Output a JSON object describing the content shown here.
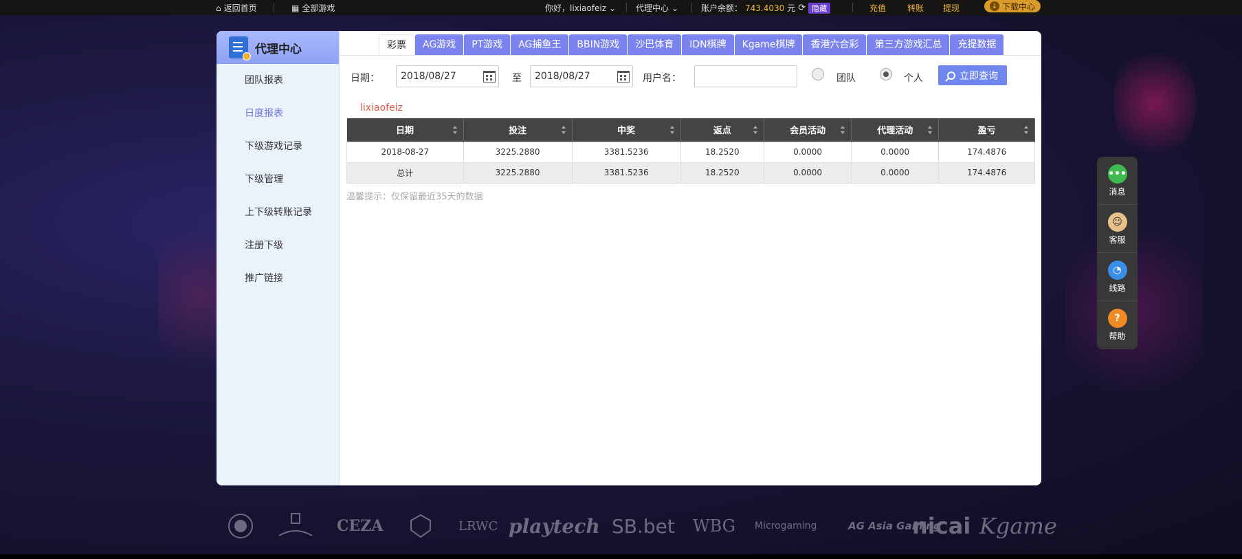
{
  "topbar": {
    "home": "返回首页",
    "all_games": "全部游戏",
    "greeting": "你好，lixiaofeiz",
    "agent_center": "代理中心",
    "balance_label": "账户余额：",
    "balance_value": "743.4030",
    "balance_unit": "元",
    "hide": "隐藏",
    "recharge": "充值",
    "transfer": "转账",
    "withdraw": "提现",
    "download": "下载中心"
  },
  "sidebar": {
    "title": "代理中心",
    "items": [
      {
        "label": "团队报表"
      },
      {
        "label": "日度报表"
      },
      {
        "label": "下级游戏记录"
      },
      {
        "label": "下级管理"
      },
      {
        "label": "上下级转账记录"
      },
      {
        "label": "注册下级"
      },
      {
        "label": "推广链接"
      }
    ]
  },
  "tabs": [
    "彩票",
    "AG游戏",
    "PT游戏",
    "AG捕鱼王",
    "BBIN游戏",
    "沙巴体育",
    "IDN棋牌",
    "Kgame棋牌",
    "香港六合彩",
    "第三方游戏汇总",
    "充提数据"
  ],
  "filters": {
    "date_label": "日期：",
    "date_from": "2018/08/27",
    "to_label": "至",
    "date_to": "2018/08/27",
    "user_label": "用户名：",
    "user_value": "",
    "team_label": "团队",
    "personal_label": "个人",
    "search_label": "立即查询"
  },
  "username": "lixiaofeiz",
  "table": {
    "headers": [
      "日期",
      "投注",
      "中奖",
      "返点",
      "会员活动",
      "代理活动",
      "盈亏"
    ],
    "rows": [
      [
        "2018-08-27",
        "3225.2880",
        "3381.5236",
        "18.2520",
        "0.0000",
        "0.0000",
        "174.4876"
      ]
    ],
    "total": [
      "总计",
      "3225.2880",
      "3381.5236",
      "18.2520",
      "0.0000",
      "0.0000",
      "174.4876"
    ]
  },
  "tip": "温馨提示：仅保留最近35天的数据",
  "floatbar": {
    "message": "消息",
    "service": "客服",
    "route": "线路",
    "help": "帮助"
  },
  "logos": [
    "CEZA",
    "LRWC",
    "playtech",
    "SB.bet",
    "WBG",
    "Microgaming",
    "AG Asia Gaming",
    "nicai",
    "Kgame"
  ],
  "colors": {
    "tab_bg": "#7b83ee",
    "accent": "#6f86ee",
    "username": "#e05a4a",
    "balance": "#f0b53a"
  }
}
